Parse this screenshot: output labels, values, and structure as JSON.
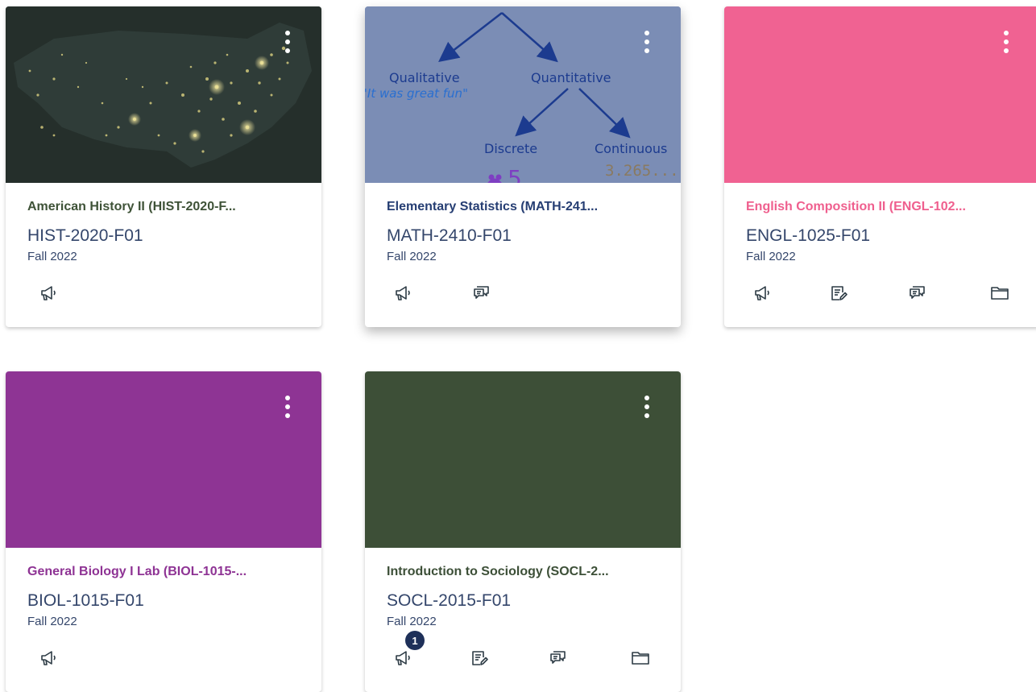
{
  "cards": [
    {
      "title": "American History II (HIST-2020-F...",
      "code": "HIST-2020-F01",
      "term": "Fall 2022",
      "color": "#3e5237",
      "hero_color": "#26302c",
      "hero_type": "map-image",
      "actions": [
        "announcements-icon"
      ]
    },
    {
      "title": "Elementary Statistics (MATH-241...",
      "code": "MATH-2410-F01",
      "term": "Fall 2022",
      "color": "#263e73",
      "hero_color": "#7b8db5",
      "hero_type": "stats-diagram",
      "hero_text": {
        "qualitative": "Qualitative",
        "quantitative": "Quantitative",
        "quote": "\"It was great fun\"",
        "discrete": "Discrete",
        "continuous": "Continuous",
        "discrete_value": "5",
        "continuous_value": "3.265..."
      },
      "actions": [
        "announcements-icon",
        "discussions-icon"
      ]
    },
    {
      "title": "English Composition II (ENGL-102...",
      "code": "ENGL-1025-F01",
      "term": "Fall 2022",
      "color": "#ef5f8e",
      "hero_color": "#f06292",
      "hero_type": "solid",
      "actions": [
        "announcements-icon",
        "assignments-icon",
        "discussions-icon",
        "files-icon"
      ]
    },
    {
      "title": "General Biology I Lab (BIOL-1015-...",
      "code": "BIOL-1015-F01",
      "term": "Fall 2022",
      "color": "#8e3394",
      "hero_color": "#8e3494",
      "hero_type": "solid",
      "actions": [
        "announcements-icon"
      ]
    },
    {
      "title": "Introduction to Sociology (SOCL-2...",
      "code": "SOCL-2015-F01",
      "term": "Fall 2022",
      "color": "#3c4f37",
      "hero_color": "#3d4f37",
      "hero_type": "solid",
      "badge": "1",
      "actions": [
        "announcements-icon",
        "assignments-icon",
        "discussions-icon",
        "files-icon"
      ]
    }
  ]
}
